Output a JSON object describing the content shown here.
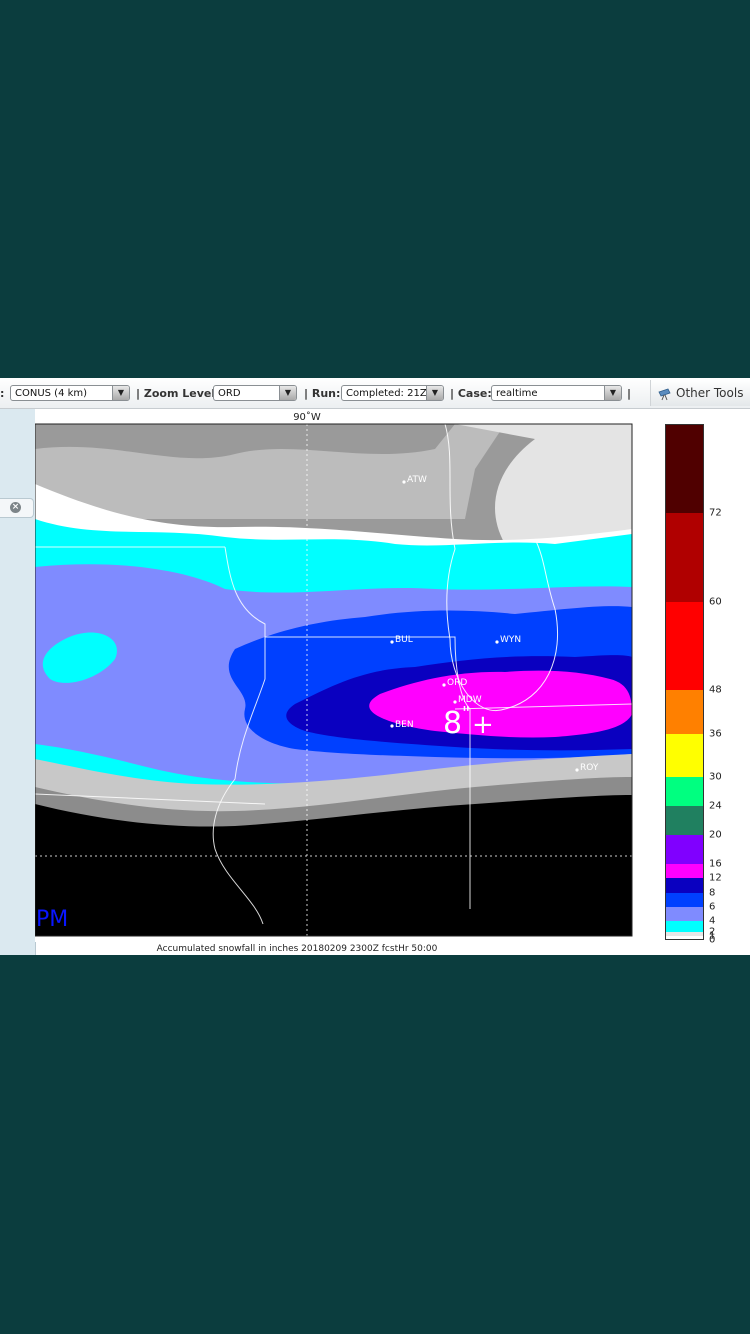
{
  "toolbar": {
    "lead_colon": ":",
    "domain_value": "CONUS (4 km)",
    "zoom_label": "| Zoom Level:",
    "zoom_value": "ORD",
    "run_label": "| Run:",
    "run_value": "Completed: 21Z",
    "case_label": "| Case:",
    "case_value": "realtime",
    "trailing_sep": "|",
    "other_tools_label": "Other Tools",
    "other_tools_icon": "telescope-icon",
    "dropdown_icon": "triangle-down-icon"
  },
  "left_panel": {
    "close_icon": "close-circle-icon",
    "close_glyph": "×"
  },
  "map": {
    "longitude_label": "90˚W",
    "stations": [
      {
        "id": "ATW"
      },
      {
        "id": "BUL"
      },
      {
        "id": "WYN"
      },
      {
        "id": "ORD"
      },
      {
        "id": "MDW"
      },
      {
        "id": "BEN"
      },
      {
        "id": "ROY"
      }
    ],
    "annotation_value": "8",
    "annotation_unit": "\"",
    "annotation_marker": "+",
    "corner_text": "PM",
    "caption": "Accumulated snowfall in inches 20180209 2300Z fcstHr 50:00"
  },
  "legend": {
    "bins": [
      {
        "color": "#ffffff"
      },
      {
        "color": "#e6e6e6"
      },
      {
        "color": "#00ffff"
      },
      {
        "color": "#7f8bff"
      },
      {
        "color": "#0040ff"
      },
      {
        "color": "#0a00c0"
      },
      {
        "color": "#ff00ff"
      },
      {
        "color": "#8000ff"
      },
      {
        "color": "#208060"
      },
      {
        "color": "#00ff80"
      },
      {
        "color": "#ffff00"
      },
      {
        "color": "#ff8000"
      },
      {
        "color": "#ff0000"
      },
      {
        "color": "#b00000"
      },
      {
        "color": "#500000"
      }
    ],
    "ticks": [
      "0",
      "1",
      "2",
      "4",
      "6",
      "8",
      "12",
      "16",
      "20",
      "24",
      "30",
      "36",
      "48",
      "60",
      "72"
    ]
  },
  "colors": {
    "page_background": "#0b3d3e",
    "snow_cyan": "#00ffff",
    "snow_periwinkle": "#7f8bff",
    "snow_blue": "#0040ff",
    "snow_navy": "#0a00c0",
    "snow_magenta": "#ff00ff",
    "no_data": "#000000"
  }
}
